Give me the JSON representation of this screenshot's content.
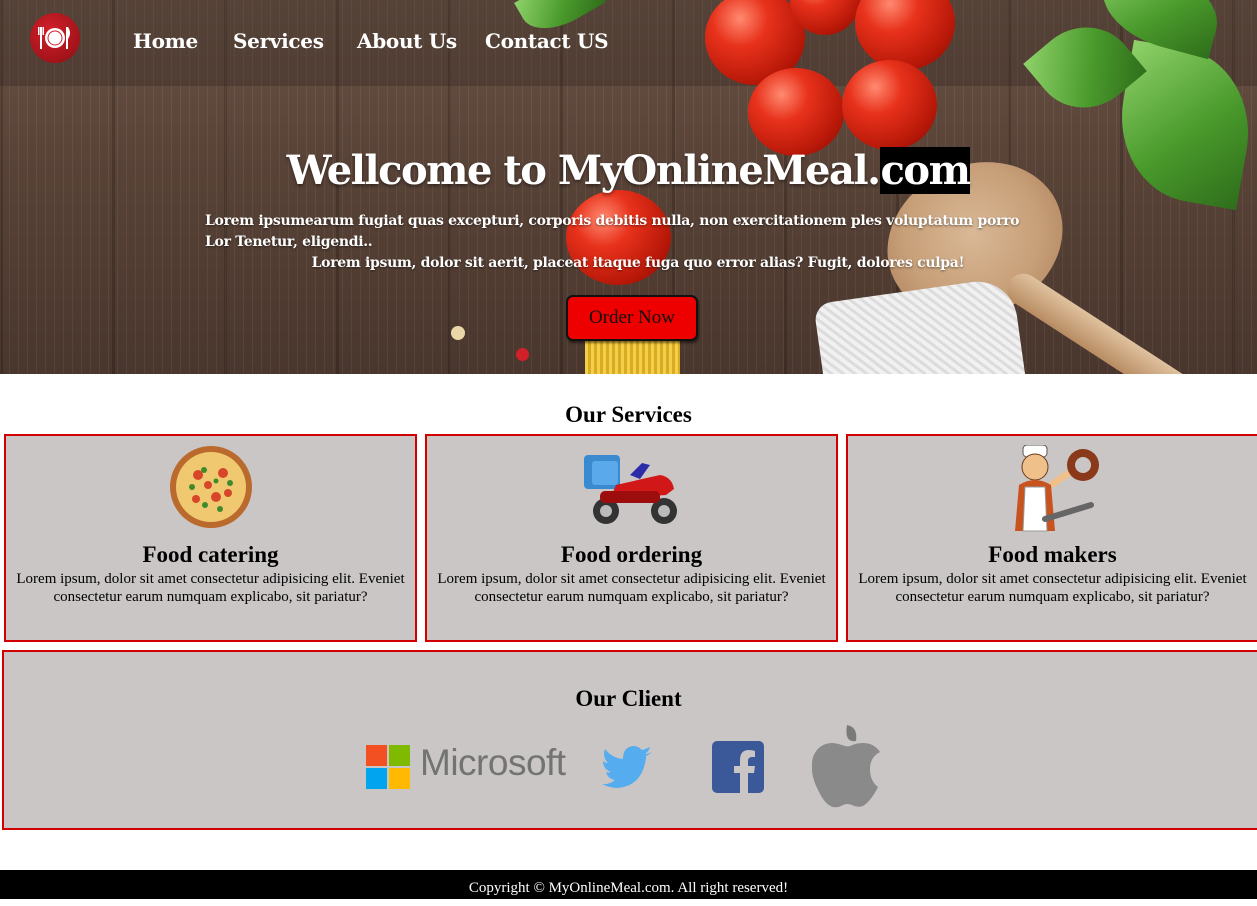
{
  "nav": {
    "items": [
      "Home",
      "Services",
      "About Us",
      "Contact US"
    ]
  },
  "hero": {
    "title_main": "Wellcome to MyOnlineMeal.",
    "title_highlight": "com",
    "text_line1": "Lorem ipsumearum fugiat quas excepturi, corporis debitis nulla, non exercitationem ples voluptatum porro Lor Tenetur, eligendi..",
    "text_line2": "Lorem ipsum, dolor sit aerit, placeat itaque fuga quo error alias? Fugit, dolores culpa!",
    "button": "Order Now"
  },
  "services": {
    "title": "Our Services",
    "cards": [
      {
        "icon": "pizza-icon",
        "title": "Food catering",
        "text": "Lorem ipsum, dolor sit amet consectetur adipisicing elit. Eveniet consectetur earum numquam explicabo, sit pariatur?"
      },
      {
        "icon": "delivery-scooter-icon",
        "title": "Food ordering",
        "text": "Lorem ipsum, dolor sit amet consectetur adipisicing elit. Eveniet consectetur earum numquam explicabo, sit pariatur?"
      },
      {
        "icon": "chef-icon",
        "title": "Food makers",
        "text": "Lorem ipsum, dolor sit amet consectetur adipisicing elit. Eveniet consectetur earum numquam explicabo, sit pariatur?"
      }
    ]
  },
  "clients": {
    "title": "Our Client",
    "logos": [
      "Microsoft",
      "twitter-logo",
      "facebook-logo",
      "apple-logo"
    ]
  },
  "footer": {
    "text": "Copyright © MyOnlineMeal.com. All right reserved!"
  },
  "colors": {
    "accent_red": "#d00000",
    "button_red": "#ee0000",
    "card_gray": "#cbc6c6",
    "footer_black": "#000000"
  }
}
